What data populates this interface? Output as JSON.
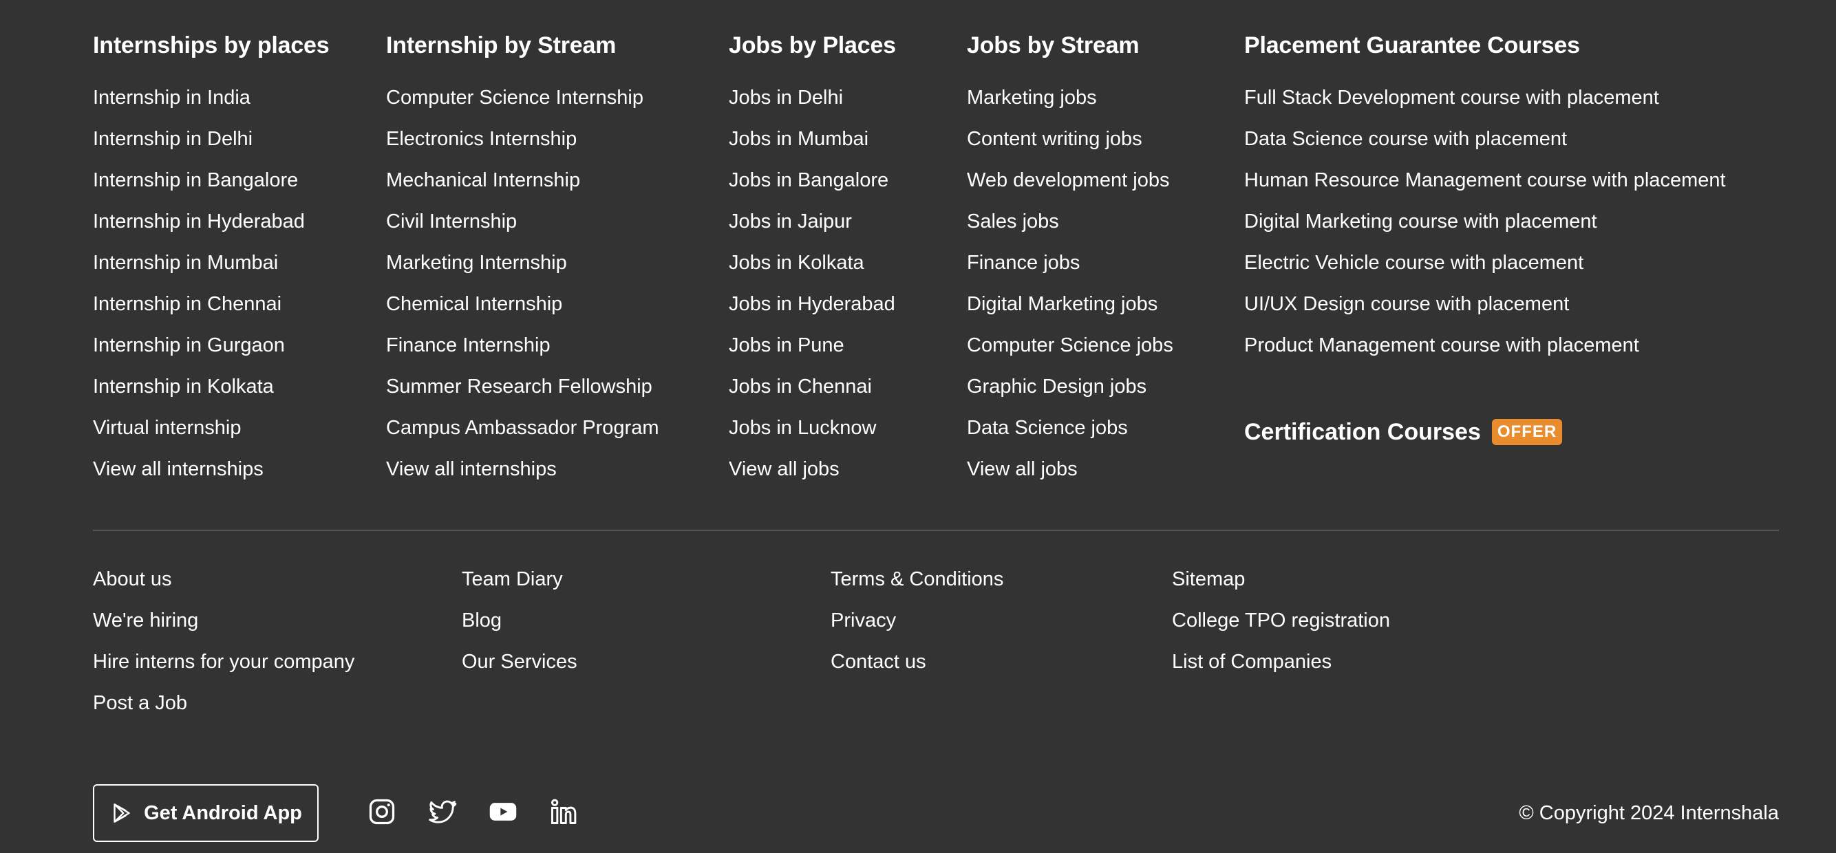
{
  "columns": [
    {
      "title": "Internships by places",
      "links": [
        "Internship in India",
        "Internship in Delhi",
        "Internship in Bangalore",
        "Internship in Hyderabad",
        "Internship in Mumbai",
        "Internship in Chennai",
        "Internship in Gurgaon",
        "Internship in Kolkata",
        "Virtual internship",
        "View all internships"
      ]
    },
    {
      "title": "Internship by Stream",
      "links": [
        "Computer Science Internship",
        "Electronics Internship",
        "Mechanical Internship",
        "Civil Internship",
        "Marketing Internship",
        "Chemical Internship",
        "Finance Internship",
        "Summer Research Fellowship",
        "Campus Ambassador Program",
        "View all internships"
      ]
    },
    {
      "title": "Jobs by Places",
      "links": [
        "Jobs in Delhi",
        "Jobs in Mumbai",
        "Jobs in Bangalore",
        "Jobs in Jaipur",
        "Jobs in Kolkata",
        "Jobs in Hyderabad",
        "Jobs in Pune",
        "Jobs in Chennai",
        "Jobs in Lucknow",
        "View all jobs"
      ]
    },
    {
      "title": "Jobs by Stream",
      "links": [
        "Marketing jobs",
        "Content writing jobs",
        "Web development jobs",
        "Sales jobs",
        "Finance jobs",
        "Digital Marketing jobs",
        "Computer Science jobs",
        "Graphic Design jobs",
        "Data Science jobs",
        "View all jobs"
      ]
    },
    {
      "title": "Placement Guarantee Courses",
      "links": [
        "Full Stack Development course with placement",
        "Data Science course with placement",
        "Human Resource Management course with placement",
        "Digital Marketing course with placement",
        "Electric Vehicle course with placement",
        "UI/UX Design course with placement",
        "Product Management course with placement"
      ]
    }
  ],
  "certification": {
    "title": "Certification Courses",
    "badge": "OFFER",
    "badge_color": "#e98c2e"
  },
  "lower_columns": [
    [
      "About us",
      "We're hiring",
      "Hire interns for your company",
      "Post a Job"
    ],
    [
      "Team Diary",
      "Blog",
      "Our Services"
    ],
    [
      "Terms & Conditions",
      "Privacy",
      "Contact us"
    ],
    [
      "Sitemap",
      "College TPO registration",
      "List of Companies"
    ]
  ],
  "bottom": {
    "android_label": "Get Android App",
    "socials": [
      "instagram-icon",
      "twitter-icon",
      "youtube-icon",
      "linkedin-icon"
    ],
    "copyright": "© Copyright 2024 Internshala"
  },
  "colors": {
    "background": "#333333",
    "text": "#ffffff",
    "divider": "#555555"
  }
}
